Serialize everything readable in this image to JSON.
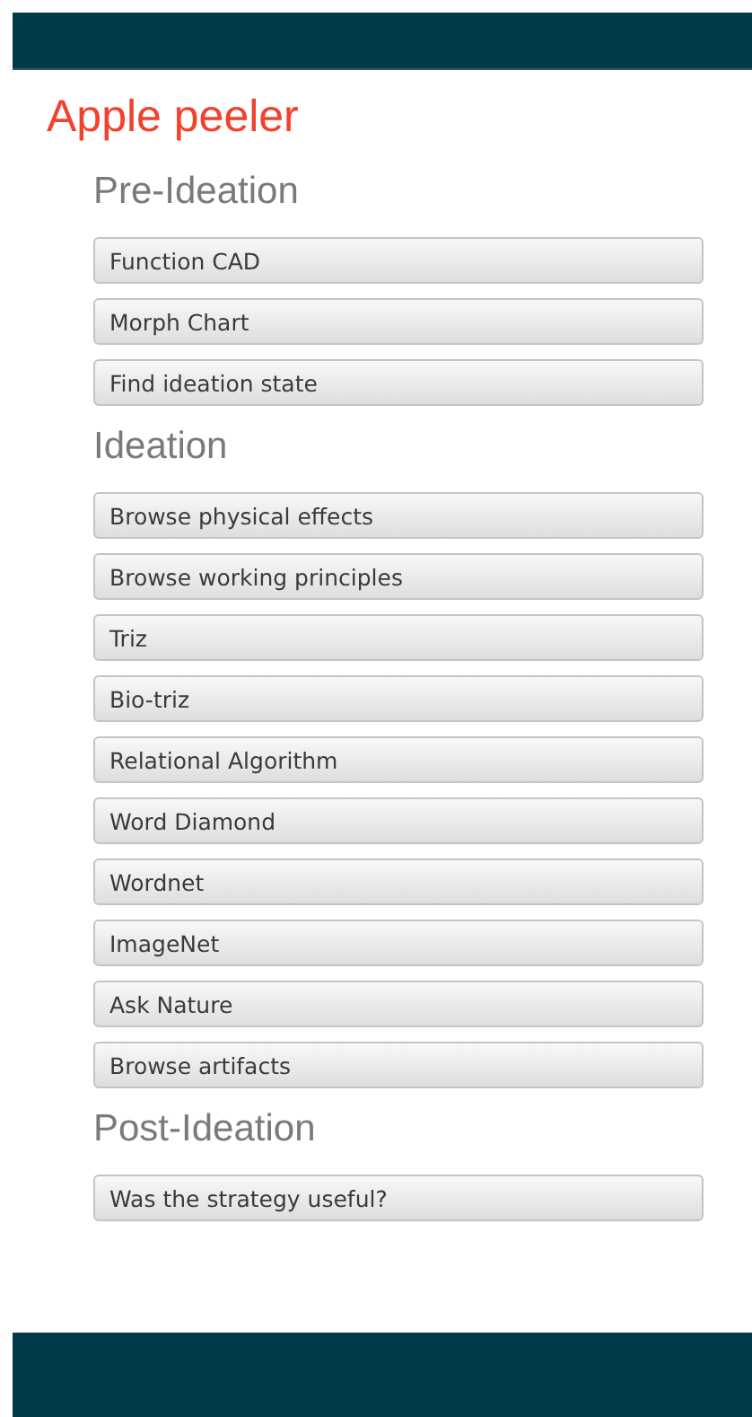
{
  "title": "Apple peeler",
  "sections": [
    {
      "heading": "Pre-Ideation",
      "buttons": [
        "Function CAD",
        "Morph Chart",
        "Find ideation state"
      ]
    },
    {
      "heading": "Ideation",
      "buttons": [
        "Browse physical effects",
        "Browse working principles",
        "Triz",
        "Bio-triz",
        "Relational Algorithm",
        "Word Diamond",
        "Wordnet",
        "ImageNet",
        "Ask Nature",
        "Browse artifacts"
      ]
    },
    {
      "heading": "Post-Ideation",
      "buttons": [
        "Was the strategy useful?"
      ]
    }
  ]
}
